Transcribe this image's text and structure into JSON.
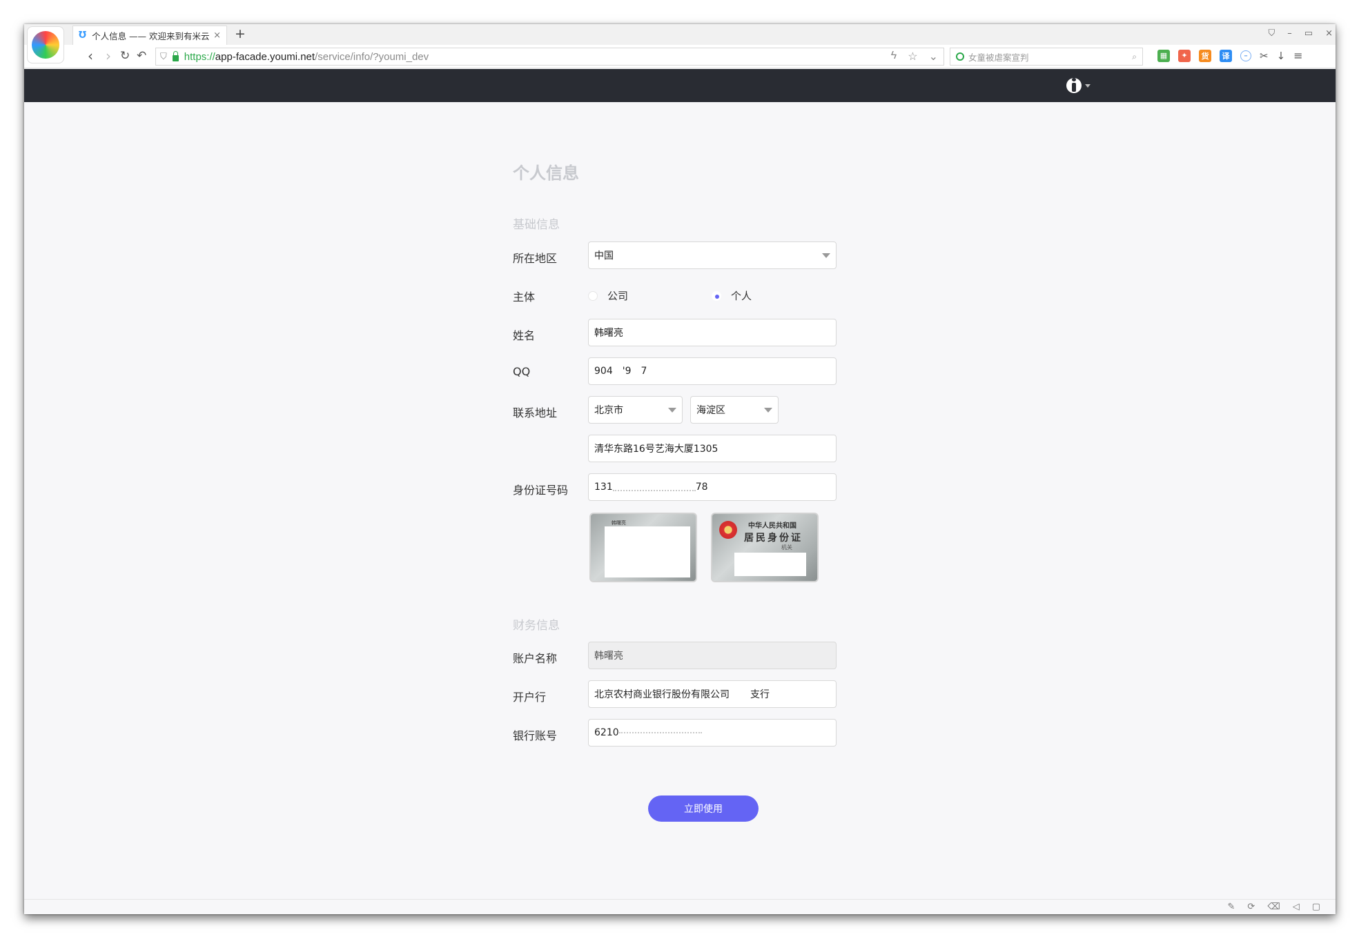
{
  "browser": {
    "tab_title": "个人信息 —— 欢迎来到有米云",
    "tab_close": "×",
    "new_tab": "+",
    "window_controls": [
      "⛉",
      "–",
      "▭",
      "×"
    ],
    "url_https": "https://",
    "url_host": "app-facade.youmi.net",
    "url_path": "/service/info/?youmi_dev",
    "search_placeholder": "女童被虐案宣判",
    "extensions": [
      {
        "name": "apps",
        "label": "▦",
        "color": "#e94f35"
      },
      {
        "name": "game",
        "label": "🎮",
        "color": "#f0654b"
      },
      {
        "name": "shopping",
        "label": "货",
        "color": "#f68b1f"
      },
      {
        "name": "translate",
        "label": "译",
        "color": "#2e8df4"
      },
      {
        "name": "adblock",
        "label": "⊖",
        "color": "#7aaef3"
      }
    ]
  },
  "page": {
    "title": "个人信息",
    "section_basic": "基础信息",
    "section_finance": "财务信息",
    "submit_label": "立即使用"
  },
  "form": {
    "region": {
      "label": "所在地区",
      "value": "中国"
    },
    "entity": {
      "label": "主体",
      "options": [
        "公司",
        "个人"
      ],
      "selected": "个人"
    },
    "name": {
      "label": "姓名",
      "value": "韩曙亮"
    },
    "qq": {
      "label": "QQ",
      "value_parts": [
        "904",
        "'9",
        "7"
      ]
    },
    "address": {
      "label": "联系地址",
      "city": "北京市",
      "district": "海淀区",
      "detail": "清华东路16号艺海大厦1305"
    },
    "id_number": {
      "label": "身份证号码",
      "prefix": "131",
      "suffix": "78"
    },
    "id_card_back": {
      "header_top": "中华人民共和国",
      "header_main": "居民身份证",
      "sub": "机关"
    },
    "id_card_front": {
      "corner": "韩曙亮"
    },
    "account_name": {
      "label": "账户名称",
      "value": "韩曙亮"
    },
    "bank": {
      "label": "开户行",
      "value_main": "北京农村商业银行股份有限公司",
      "value_tail": "支行"
    },
    "bank_account": {
      "label": "银行账号",
      "prefix": "6210"
    }
  }
}
